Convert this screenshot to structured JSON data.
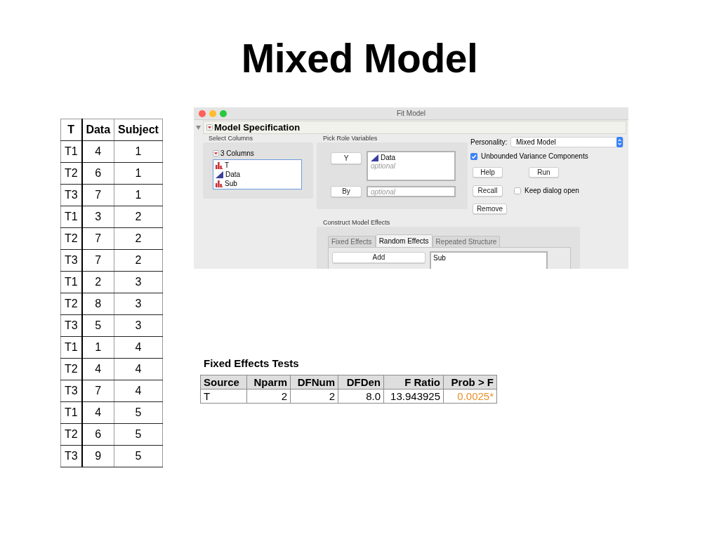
{
  "slide_title": "Mixed Model",
  "data_table": {
    "columns": [
      "T",
      "Data",
      "Subject"
    ],
    "rows": [
      [
        "T1",
        "4",
        "1"
      ],
      [
        "T2",
        "6",
        "1"
      ],
      [
        "T3",
        "7",
        "1"
      ],
      [
        "T1",
        "3",
        "2"
      ],
      [
        "T2",
        "7",
        "2"
      ],
      [
        "T3",
        "7",
        "2"
      ],
      [
        "T1",
        "2",
        "3"
      ],
      [
        "T2",
        "8",
        "3"
      ],
      [
        "T3",
        "5",
        "3"
      ],
      [
        "T1",
        "1",
        "4"
      ],
      [
        "T2",
        "4",
        "4"
      ],
      [
        "T3",
        "7",
        "4"
      ],
      [
        "T1",
        "4",
        "5"
      ],
      [
        "T2",
        "6",
        "5"
      ],
      [
        "T3",
        "9",
        "5"
      ]
    ]
  },
  "fit_model_window": {
    "title": "Fit Model",
    "outline": {
      "title": "Model Specification",
      "expanded": true
    },
    "select_columns": {
      "label": "Select Columns",
      "list_title": "3 Columns",
      "columns": [
        {
          "name": "T",
          "kind": "nominal"
        },
        {
          "name": "Data",
          "kind": "continuous"
        },
        {
          "name": "Sub",
          "kind": "nominal"
        }
      ]
    },
    "pick_role_variables": {
      "label": "Pick Role Variables",
      "roles": [
        {
          "button": "Y",
          "kind": "list",
          "items": [
            {
              "name": "Data",
              "kind": "continuous"
            }
          ],
          "placeholder": "optional"
        },
        {
          "button": "By",
          "kind": "field",
          "placeholder": "optional"
        }
      ]
    },
    "personality": {
      "label": "Personality:",
      "value": "Mixed Model"
    },
    "unbounded_variance_components": {
      "label": "Unbounded Variance Components",
      "checked": true
    },
    "buttons": [
      "Help",
      "Run",
      "Recall",
      "Remove"
    ],
    "keep_dialog_open": {
      "label": "Keep dialog open",
      "checked": false
    },
    "construct_model_effects": {
      "label": "Construct Model Effects",
      "tabs": [
        {
          "label": "Fixed Effects",
          "selected": false
        },
        {
          "label": "Random Effects",
          "selected": true
        },
        {
          "label": "Repeated Structure",
          "selected": false
        }
      ],
      "add_button": "Add",
      "effects": [
        "Sub"
      ]
    }
  },
  "fixed_effects_tests": {
    "title": "Fixed Effects Tests",
    "columns": [
      "Source",
      "Nparm",
      "DFNum",
      "DFDen",
      "F Ratio",
      "Prob > F"
    ],
    "rows": [
      {
        "cells": [
          "T",
          "2",
          "2",
          "8.0",
          "13.943925",
          "0.0025*"
        ],
        "significant": true
      }
    ]
  }
}
